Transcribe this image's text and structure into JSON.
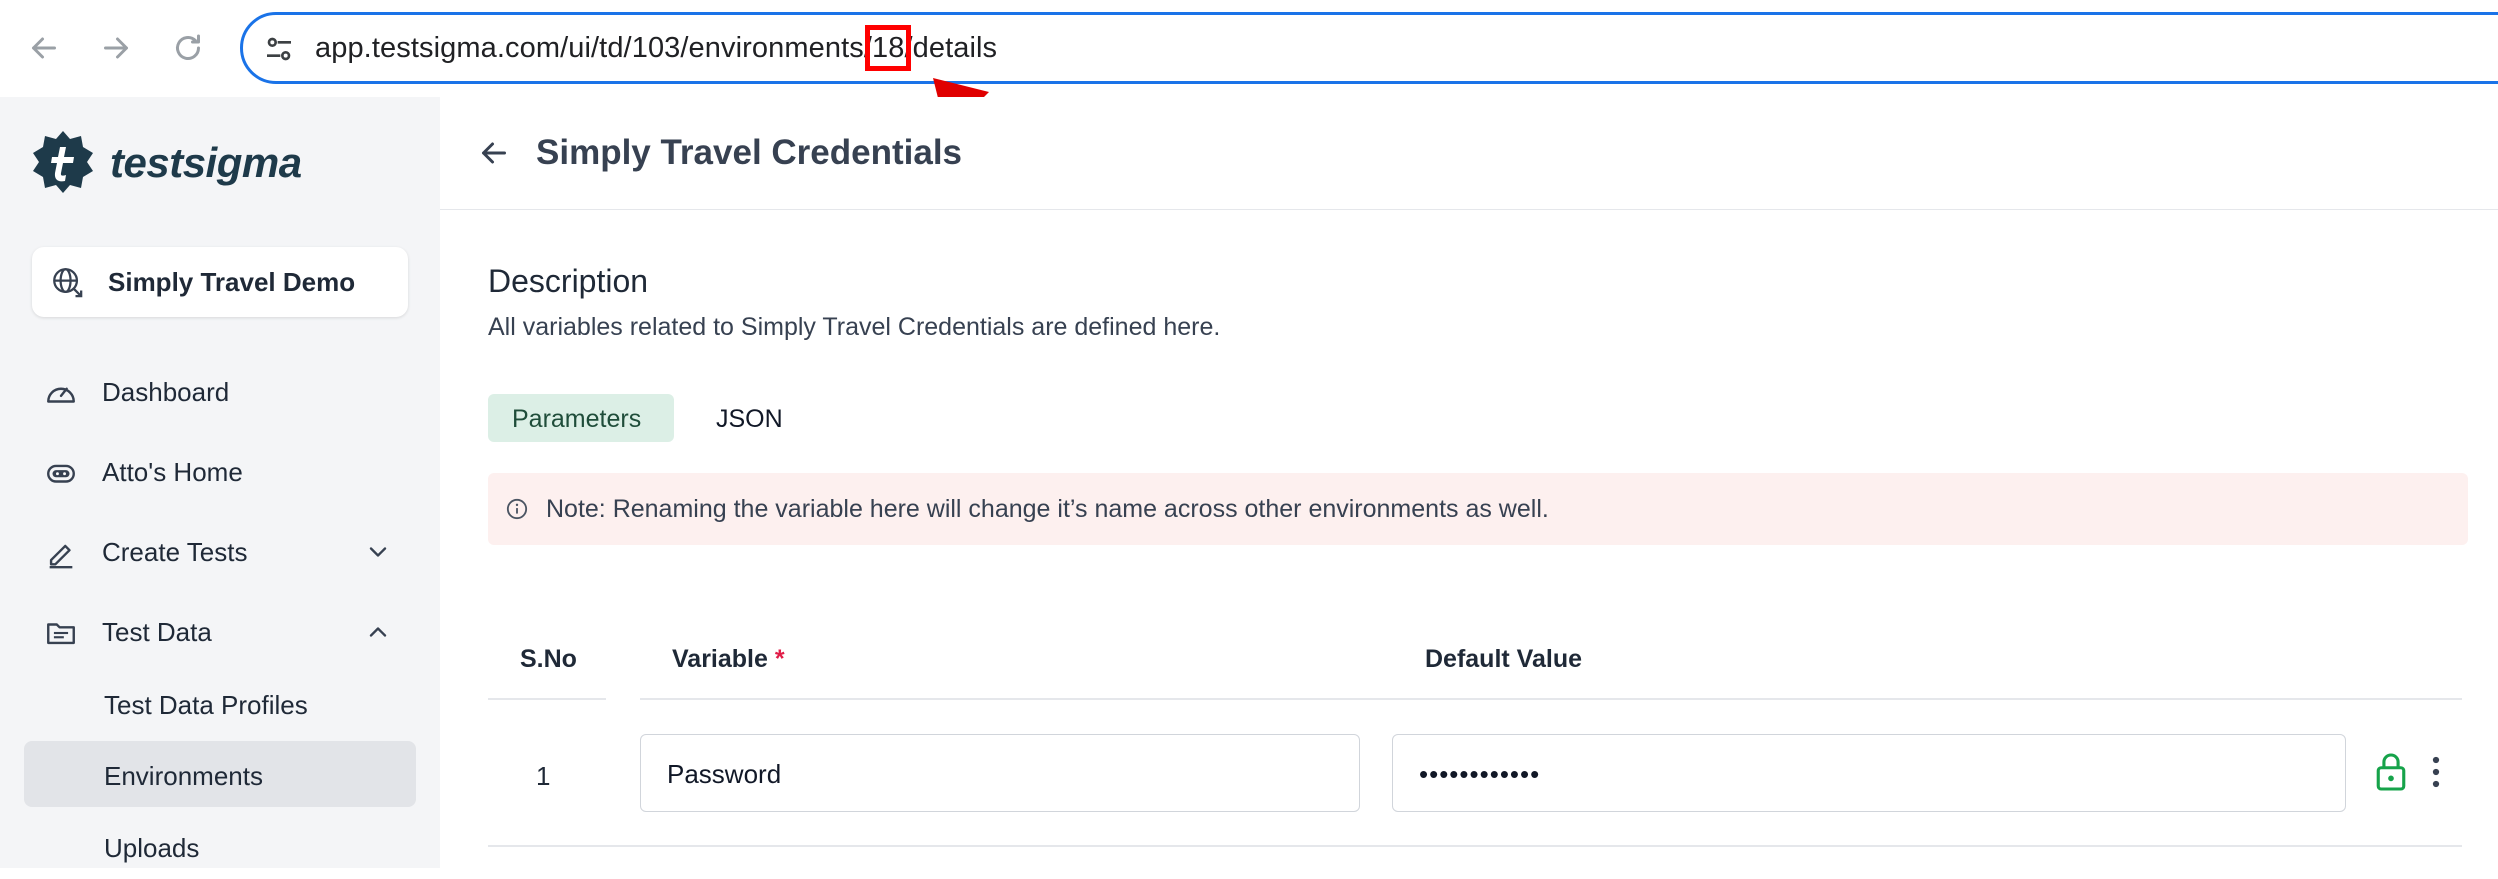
{
  "browser": {
    "url_prefix": "app.testsigma.com/ui/td/103/environments/",
    "url_highlight": "18",
    "url_suffix": "/details"
  },
  "sidebar": {
    "logo_text": "testsigma",
    "project_name": "Simply Travel Demo",
    "items": [
      {
        "label": "Dashboard",
        "icon": "dashboard-gauge-icon"
      },
      {
        "label": "Atto's Home",
        "icon": "atto-robot-icon"
      },
      {
        "label": "Create Tests",
        "icon": "pencil-icon",
        "expanded": false
      },
      {
        "label": "Test Data",
        "icon": "folder-icon",
        "expanded": true
      }
    ],
    "sub_items": [
      {
        "label": "Test Data Profiles",
        "active": false
      },
      {
        "label": "Environments",
        "active": true
      },
      {
        "label": "Uploads",
        "active": false
      }
    ]
  },
  "main": {
    "title": "Simply Travel Credentials",
    "description_heading": "Description",
    "description_text": "All variables related to Simply Travel Credentials are defined here.",
    "tabs": [
      {
        "label": "Parameters",
        "active": true
      },
      {
        "label": "JSON",
        "active": false
      }
    ],
    "note": "Note: Renaming the variable here will change it’s name across other environments as well.",
    "table": {
      "headers": {
        "sno": "S.No",
        "variable": "Variable",
        "required_mark": "*",
        "default_value": "Default Value"
      },
      "rows": [
        {
          "sno": "1",
          "variable": "Password",
          "default_value": "••••••••••••",
          "locked": true
        }
      ]
    }
  },
  "colors": {
    "accent_blue": "#1a73e8",
    "highlight_red": "#ff0000",
    "tab_active_bg": "#dcefe6",
    "note_bg": "#fdf0ef",
    "lock_green": "#16a34a"
  }
}
